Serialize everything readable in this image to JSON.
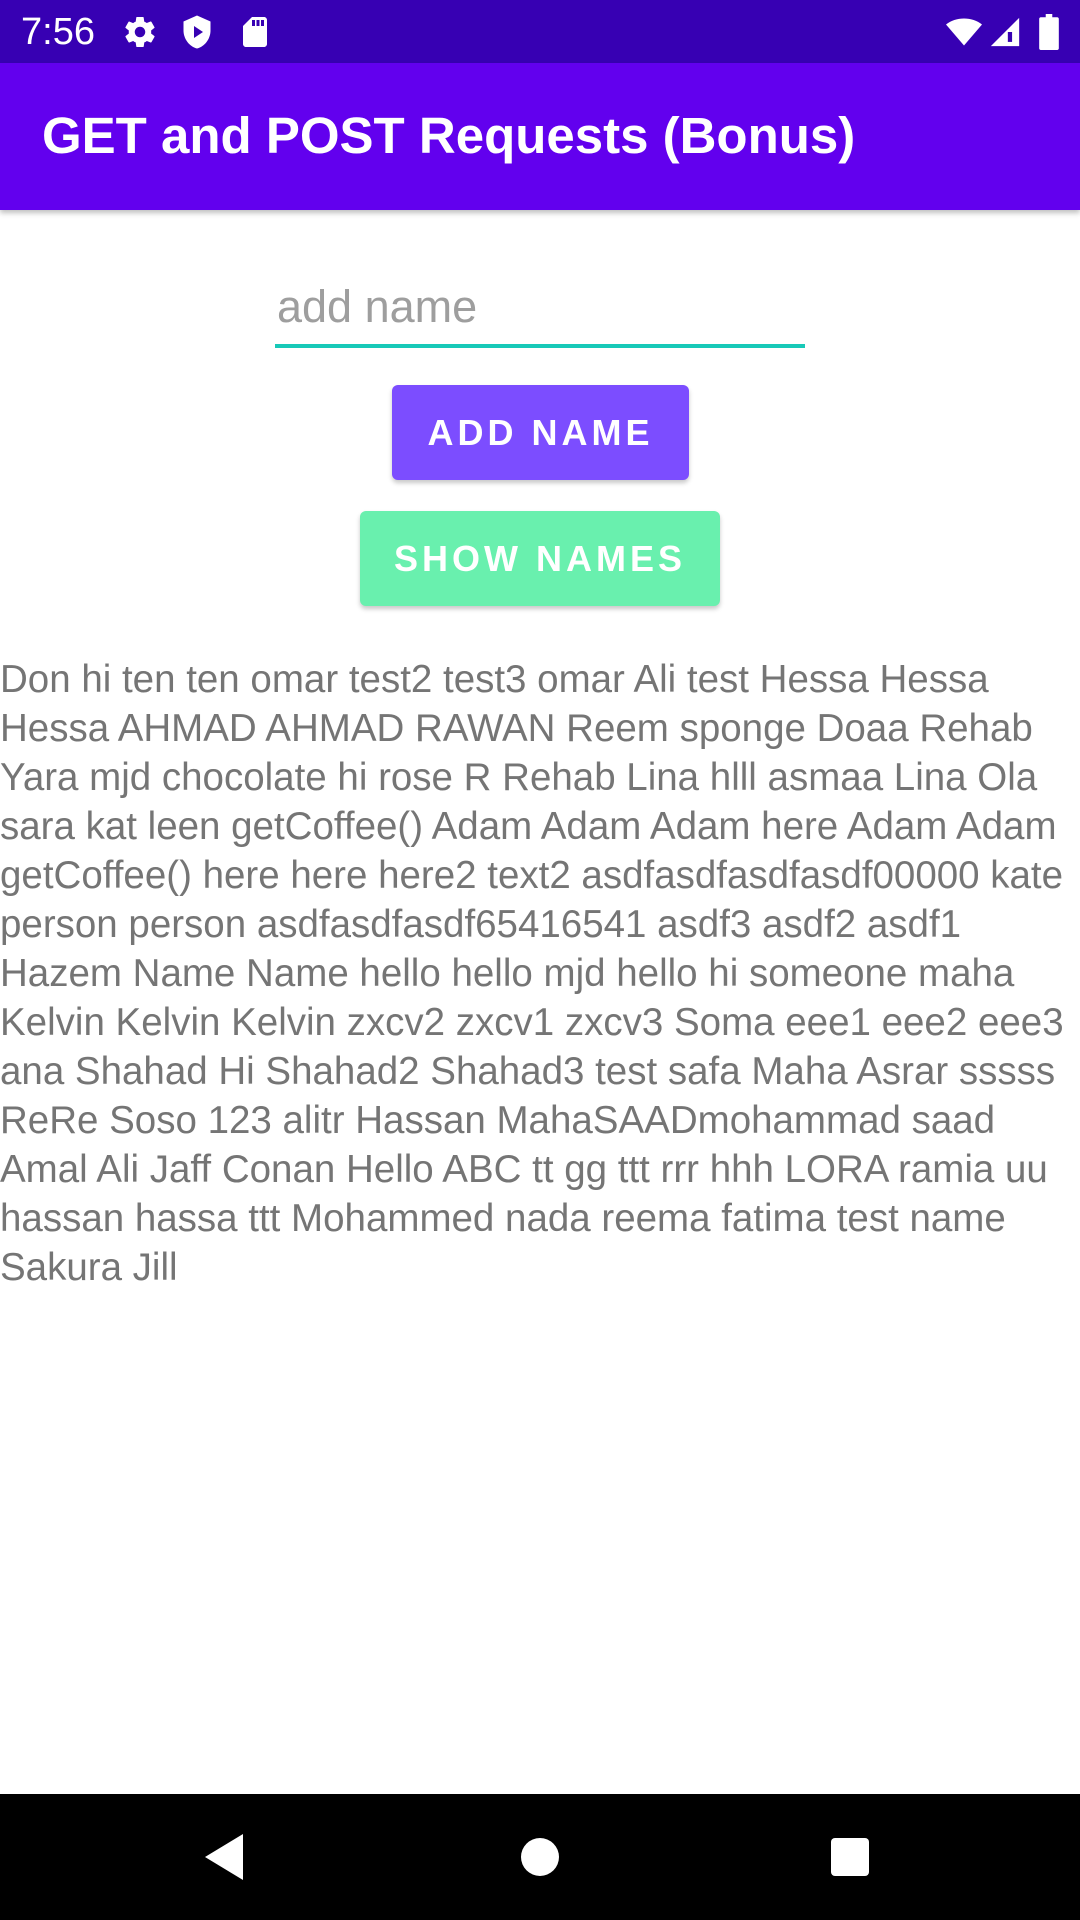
{
  "status_bar": {
    "time": "7:56",
    "icons_left": [
      "gear-icon",
      "play-shield-icon",
      "sd-card-icon"
    ],
    "icons_right": [
      "wifi-icon",
      "cell-signal-icon",
      "battery-icon"
    ]
  },
  "app_bar": {
    "title": "GET and POST Requests (Bonus)"
  },
  "form": {
    "name_placeholder": "add name",
    "name_value": "",
    "add_button_label": "ADD NAME",
    "show_button_label": "SHOW NAMES"
  },
  "names_output": "Don hi ten ten omar test2 test3 omar Ali test Hessa Hessa Hessa AHMAD AHMAD RAWAN Reem sponge Doaa Rehab Yara mjd chocolate hi rose R Rehab Lina hlll asmaa Lina Ola sara kat leen getCoffee() Adam Adam Adam here Adam Adam getCoffee() here here here2 text2 asdfasdfasdfasdf00000 kate person person asdfasdfasdf65416541 asdf3 asdf2 asdf1 Hazem Name Name hello hello mjd hello hi someone maha Kelvin Kelvin Kelvin zxcv2 zxcv1 zxcv3 Soma eee1 eee2 eee3 ana Shahad Hi Shahad2 Shahad3 test safa Maha Asrar sssss ReRe Soso 123 alitr Hassan MahaSAADmohammad saad Amal Ali Jaff Conan Hello ABC tt gg ttt rrr hhh LORA ramia uu hassan hassa ttt Mohammed nada reema fatima test name Sakura Jill",
  "colors": {
    "status_bar": "#3700b3",
    "app_bar": "#6200ee",
    "add_button": "#7c4dff",
    "show_button": "#69f0ae",
    "input_underline": "#18c9b8"
  },
  "nav_bar": {
    "icons": [
      "back-icon",
      "home-icon",
      "recents-icon"
    ]
  }
}
